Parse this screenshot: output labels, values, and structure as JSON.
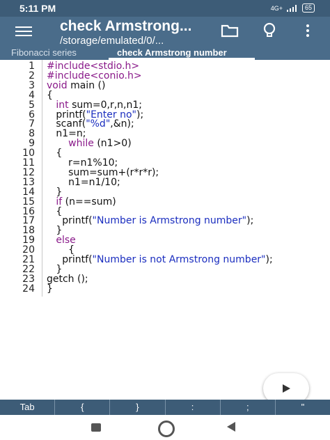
{
  "status_bar": {
    "time": "5:11 PM",
    "network": "4G+",
    "battery": "65"
  },
  "app_bar": {
    "title": "check Armstrong...",
    "subtitle": "/storage/emulated/0/...",
    "icons": [
      "menu-icon",
      "folder-icon",
      "lightbulb-icon",
      "more-vert-icon"
    ]
  },
  "tabs": [
    {
      "label": "Fibonacci series"
    },
    {
      "label": "check Armstrong number"
    }
  ],
  "editor": {
    "lines": [
      {
        "num": "1",
        "parts": [
          {
            "t": "#include<stdio.h>",
            "c": "kw"
          }
        ]
      },
      {
        "num": "2",
        "parts": [
          {
            "t": "#include<conio.h>",
            "c": "kw"
          }
        ]
      },
      {
        "num": "3",
        "parts": [
          {
            "t": "void",
            "c": "kw"
          },
          {
            "t": " main ()",
            "c": ""
          }
        ]
      },
      {
        "num": "4",
        "parts": [
          {
            "t": "{",
            "c": ""
          }
        ]
      },
      {
        "num": "5",
        "parts": [
          {
            "t": "   ",
            "c": ""
          },
          {
            "t": "int",
            "c": "kw"
          },
          {
            "t": " sum=0,r,n,n1;",
            "c": ""
          }
        ]
      },
      {
        "num": "6",
        "parts": [
          {
            "t": "   printf(",
            "c": ""
          },
          {
            "t": "\"Enter no\"",
            "c": "str"
          },
          {
            "t": ");",
            "c": ""
          }
        ]
      },
      {
        "num": "7",
        "parts": [
          {
            "t": "   scanf(",
            "c": ""
          },
          {
            "t": "\"%d\"",
            "c": "str"
          },
          {
            "t": ",&n);",
            "c": ""
          }
        ]
      },
      {
        "num": "8",
        "parts": [
          {
            "t": "   n1=n;",
            "c": ""
          }
        ]
      },
      {
        "num": "9",
        "parts": [
          {
            "t": "       ",
            "c": ""
          },
          {
            "t": "while",
            "c": "kw"
          },
          {
            "t": " (n1>0)",
            "c": ""
          }
        ]
      },
      {
        "num": "10",
        "parts": [
          {
            "t": "   {",
            "c": ""
          }
        ]
      },
      {
        "num": "11",
        "parts": [
          {
            "t": "       r=n1%10;",
            "c": ""
          }
        ]
      },
      {
        "num": "12",
        "parts": [
          {
            "t": "       sum=sum+(r*r*r);",
            "c": ""
          }
        ]
      },
      {
        "num": "13",
        "parts": [
          {
            "t": "       n1=n1/10;",
            "c": ""
          }
        ]
      },
      {
        "num": "14",
        "parts": [
          {
            "t": "   }",
            "c": ""
          }
        ]
      },
      {
        "num": "15",
        "parts": [
          {
            "t": "   ",
            "c": ""
          },
          {
            "t": "if",
            "c": "kw"
          },
          {
            "t": " (n==sum)",
            "c": ""
          }
        ]
      },
      {
        "num": "16",
        "parts": [
          {
            "t": "   {",
            "c": ""
          }
        ]
      },
      {
        "num": "17",
        "parts": [
          {
            "t": "     printf(",
            "c": ""
          },
          {
            "t": "\"Number is Armstrong number\"",
            "c": "str"
          },
          {
            "t": ");",
            "c": ""
          }
        ]
      },
      {
        "num": "18",
        "parts": [
          {
            "t": "   }",
            "c": ""
          }
        ]
      },
      {
        "num": "19",
        "parts": [
          {
            "t": "   ",
            "c": ""
          },
          {
            "t": "else",
            "c": "kw"
          }
        ]
      },
      {
        "num": "20",
        "parts": [
          {
            "t": "       {",
            "c": ""
          }
        ]
      },
      {
        "num": "21",
        "parts": [
          {
            "t": "     printf(",
            "c": ""
          },
          {
            "t": "\"Number is not Armstrong number\"",
            "c": "str"
          },
          {
            "t": ");",
            "c": ""
          }
        ]
      },
      {
        "num": "22",
        "parts": [
          {
            "t": "   }",
            "c": ""
          }
        ]
      },
      {
        "num": "23",
        "parts": [
          {
            "t": "getch ();",
            "c": ""
          }
        ]
      },
      {
        "num": "24",
        "parts": [
          {
            "t": "}",
            "c": ""
          }
        ]
      }
    ]
  },
  "keys": [
    {
      "label": "Tab"
    },
    {
      "label": "{"
    },
    {
      "label": "}"
    },
    {
      "label": ":"
    },
    {
      "label": ";"
    },
    {
      "label": "\""
    }
  ],
  "colors": {
    "app_bar": "#4a6c8a",
    "status_bar": "#3d5c77",
    "keyword": "#8a1a8a",
    "string": "#1a2dbf"
  }
}
